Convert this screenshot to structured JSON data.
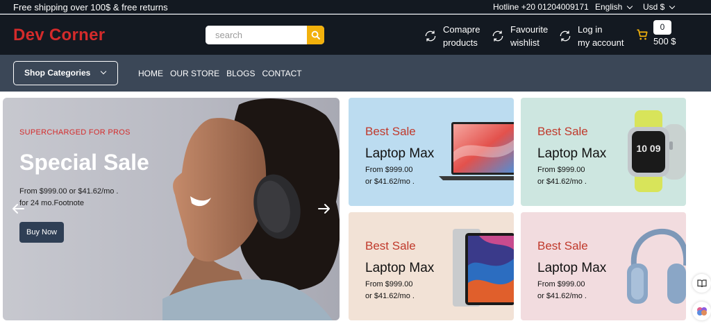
{
  "topbar": {
    "shipping_text": "Free shipping over 100$ & free returns",
    "hotline": "Hotline +20 01204009171",
    "language": "English",
    "currency": "Usd $"
  },
  "header": {
    "logo": "Dev Corner",
    "search_placeholder": "search",
    "compare_line1": "Comapre",
    "compare_line2": "products",
    "wishlist_line1": "Favourite",
    "wishlist_line2": "wishlist",
    "login_line1": "Log in",
    "login_line2": "my account",
    "cart_count": "0",
    "cart_total": "500 $"
  },
  "nav": {
    "categories_label": "Shop Categories",
    "links": [
      "HOME",
      "OUR STORE",
      "BLOGS",
      "CONTACT"
    ]
  },
  "hero": {
    "tag": "SUPERCHARGED FOR PROS",
    "title": "Special Sale",
    "desc_line1": "From $999.00 or $41.62/mo .",
    "desc_line2": "for 24 mo.Footnote",
    "button": "Buy Now"
  },
  "cards": [
    {
      "badge": "Best Sale",
      "name": "Laptop Max",
      "price1": "From $999.00",
      "price2": "or $41.62/mo .",
      "bg": "#bcdcf0",
      "product": "laptop"
    },
    {
      "badge": "Best Sale",
      "name": "Laptop Max",
      "price1": "From $999.00",
      "price2": "or $41.62/mo .",
      "bg": "#cde6e0",
      "product": "smartwatch"
    },
    {
      "badge": "Best Sale",
      "name": "Laptop Max",
      "price1": "From $999.00",
      "price2": "or $41.62/mo .",
      "bg": "#f2e2d6",
      "product": "tablet"
    },
    {
      "badge": "Best Sale",
      "name": "Laptop Max",
      "price1": "From $999.00",
      "price2": "or $41.62/mo .",
      "bg": "#f2dcdf",
      "product": "headphones"
    }
  ],
  "watch_time": "10 09",
  "colors": {
    "dark": "#131921",
    "nav": "#3b4757",
    "brand_red": "#d42b2b",
    "accent": "#f2b10c"
  }
}
